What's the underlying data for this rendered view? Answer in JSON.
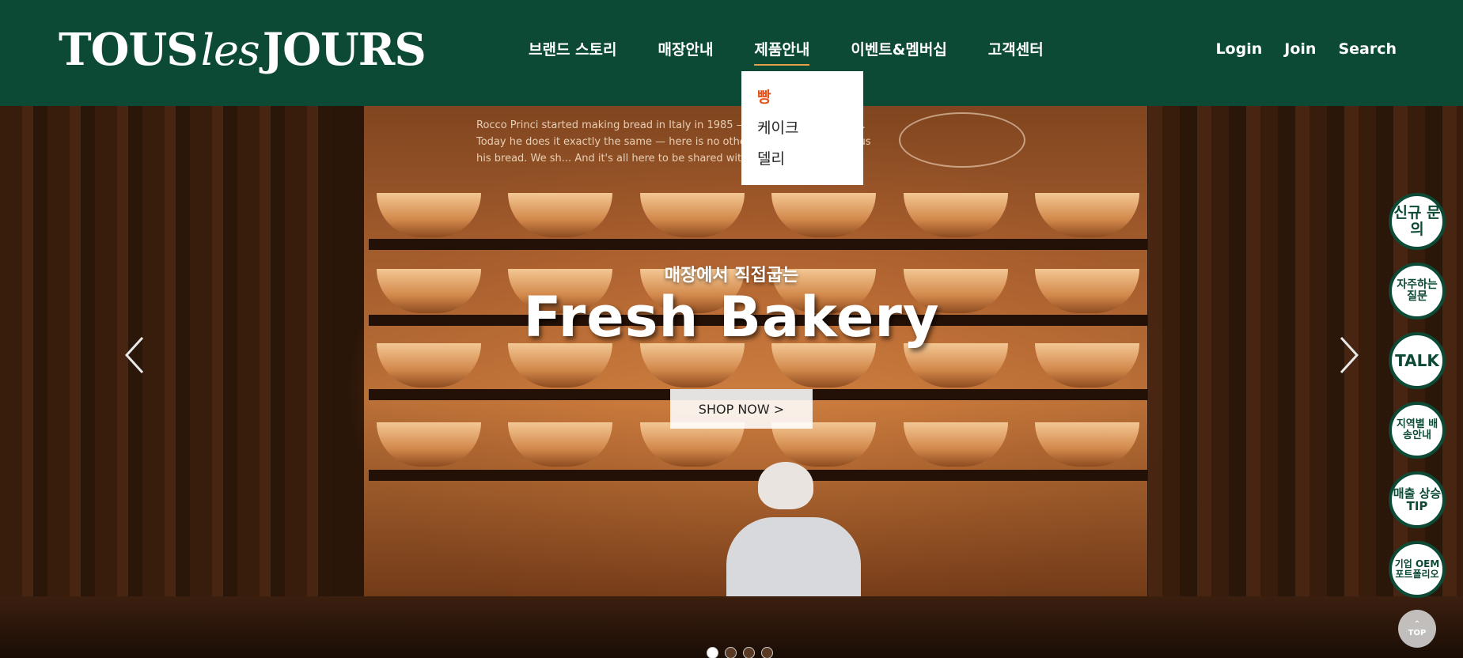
{
  "brand": {
    "logo_main_1": "TOUS",
    "logo_les": "les",
    "logo_main_2": "JOURS"
  },
  "nav": {
    "items": [
      {
        "label": "브랜드 스토리"
      },
      {
        "label": "매장안내"
      },
      {
        "label": "제품안내"
      },
      {
        "label": "이벤트&멤버십"
      },
      {
        "label": "고객센터"
      }
    ],
    "active_index": 2
  },
  "util": {
    "login": "Login",
    "join": "Join",
    "search": "Search"
  },
  "dropdown": {
    "items": [
      {
        "label": "빵"
      },
      {
        "label": "케이크"
      },
      {
        "label": "델리"
      }
    ]
  },
  "hero": {
    "subtitle": "매장에서 직접굽는",
    "title": "Fresh Bakery",
    "cta": "SHOP NOW >",
    "wall_text": "Rocco Princi started making bread in Italy in 1985 — with high-quality flour. Today he does it exactly the same — here is no other way. He shares with us his bread. We sh... And it's all here to be shared with you.",
    "slide_count": 4,
    "active_slide": 0
  },
  "side": {
    "buttons": [
      {
        "label": "신규 문의"
      },
      {
        "label": "자주하는 질문"
      },
      {
        "label": "TALK"
      },
      {
        "label": "지역별 배송안내"
      },
      {
        "label": "매출 상승 TIP"
      },
      {
        "label": "기업 OEM 포트폴리오"
      }
    ],
    "top": "TOP"
  },
  "colors": {
    "brand_green": "#0c4a35",
    "accent_orange": "#e2541f"
  }
}
